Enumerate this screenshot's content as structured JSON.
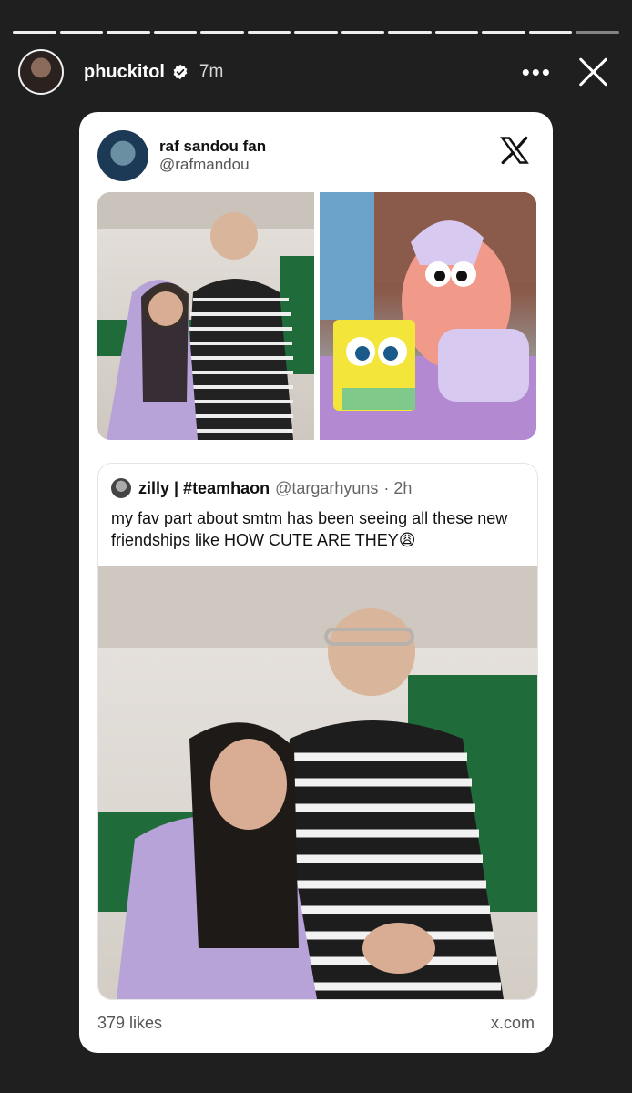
{
  "story": {
    "username": "phuckitol",
    "time": "7m",
    "more_label": "•••",
    "segments": 13
  },
  "tweet": {
    "display_name": "raf sandou fan",
    "handle": "@rafmandou",
    "quoted": {
      "name": "zilly | #teamhaon",
      "handle": "@targarhyuns",
      "time": "· 2h",
      "text": "my fav part about smtm has been seeing all these new friendships like HOW CUTE ARE THEY😩"
    },
    "likes": "379 likes",
    "domain": "x.com"
  },
  "colors": {
    "background": "#1f1f1f",
    "card": "#ffffff",
    "lilac": "#b8a3d8",
    "sign_green": "#1f6b3a"
  },
  "icons": {
    "verified": "verified-badge-icon",
    "more": "more-icon",
    "close": "close-icon",
    "x_logo": "x-logo-icon"
  }
}
